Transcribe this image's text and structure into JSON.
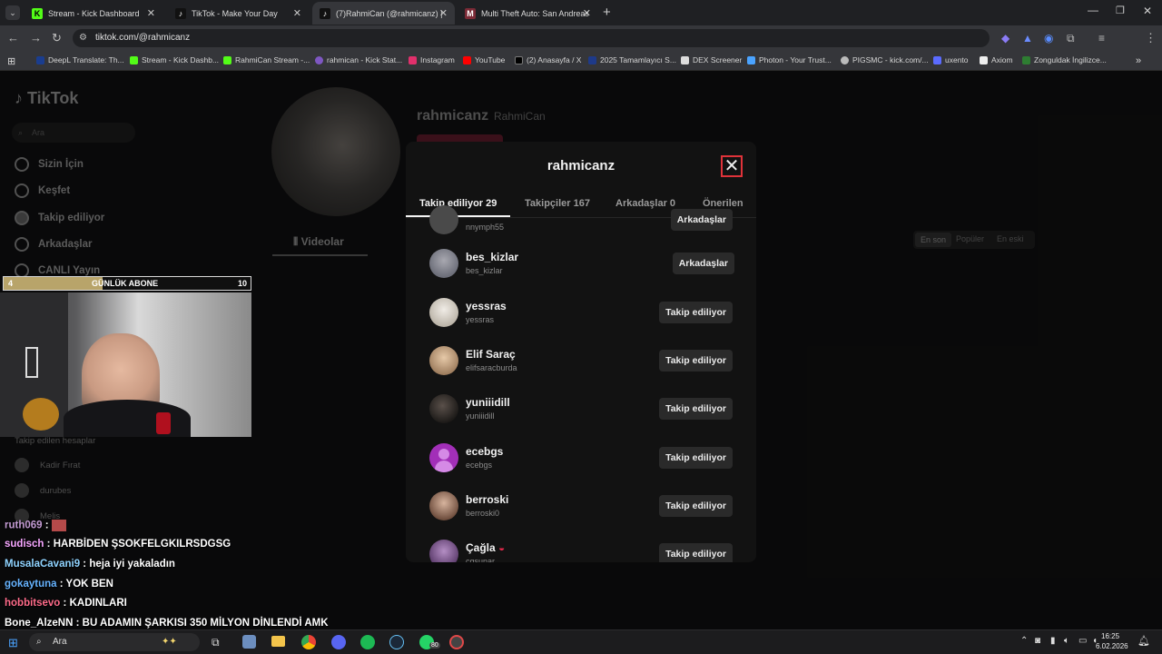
{
  "browser": {
    "tabs": [
      {
        "title": "Stream - Kick Dashboard",
        "favicon": "kick-icon"
      },
      {
        "title": "TikTok - Make Your Day",
        "favicon": "tiktok-icon"
      },
      {
        "title": "(7)RahmiCan (@rahmicanz) | Ti",
        "favicon": "tiktok-icon"
      },
      {
        "title": "Multi Theft Auto: San Andreas",
        "favicon": "mta-icon"
      }
    ],
    "url": "tiktok.com/@rahmicanz",
    "bookmarks": [
      "DeepL Translate: Th...",
      "Stream - Kick Dashb...",
      "RahmiCan Stream -...",
      "rahmican - Kick Stat...",
      "Instagram",
      "YouTube",
      "(2) Anasayfa / X",
      "2025 Tamamlayıcı S...",
      "DEX Screener",
      "Photon - Your Trust...",
      "PIGSMC - kick.com/...",
      "uxento",
      "Axiom",
      "Zonguldak İngilizce..."
    ]
  },
  "tiktok": {
    "logo": "TikTok",
    "search_placeholder": "Ara",
    "nav": [
      "Sizin İçin",
      "Keşfet",
      "Takip ediliyor",
      "Arkadaşlar",
      "CANLI Yayın"
    ],
    "profile": {
      "username": "rahmicanz",
      "display_name": "RahmiCan",
      "tab_videos": "Videolar",
      "sort": [
        "En son",
        "Popüler",
        "En eski"
      ]
    },
    "following_header": "Takip edilen hesaplar",
    "following_sidebar": [
      "Kadir Fırat",
      "durubes",
      "Melis"
    ]
  },
  "modal": {
    "title": "rahmicanz",
    "tabs": [
      "Takip ediliyor 29",
      "Takipçiler 167",
      "Arkadaşlar 0",
      "Önerilen"
    ],
    "partial_top": {
      "handle": "nnymph55",
      "button": "Arkadaşlar"
    },
    "users": [
      {
        "name": "bes_kizlar",
        "handle": "bes_kizlar",
        "button": "Arkadaşlar",
        "color": "#6d6f7a"
      },
      {
        "name": "yessras",
        "handle": "yessras",
        "button": "Takip ediliyor",
        "color": "#d9d4cc"
      },
      {
        "name": "Elif Saraç",
        "handle": "elifsaracburda",
        "button": "Takip ediliyor",
        "color": "#c6a98a"
      },
      {
        "name": "yuniiidill",
        "handle": "yuniiidill",
        "button": "Takip ediliyor",
        "color": "#3a3430"
      },
      {
        "name": "ecebgs",
        "handle": "ecebgs",
        "button": "Takip ediliyor",
        "color": "#a22fb8"
      },
      {
        "name": "berroski",
        "handle": "berroski0",
        "button": "Takip ediliyor",
        "color": "#8d6e63"
      },
      {
        "name": "Çağla",
        "handle": "cgsunar",
        "button": "Takip ediliyor",
        "color": "#7e5a8f"
      }
    ]
  },
  "overlay": {
    "abone_left": "4",
    "abone_label": "GÜNLÜK ABONE",
    "abone_right": "10",
    "abone_progress": 0.4,
    "chat": [
      {
        "user": "ruth069",
        "msg": "",
        "color": "#c39bd3"
      },
      {
        "user": "sudisch",
        "msg": "HARBİDEN ŞSOKFELGKILRSDGSG",
        "color": "#f6a6ff"
      },
      {
        "user": "MusalaCavani9",
        "msg": "heja iyi yakaladın",
        "color": "#8fd3ff"
      },
      {
        "user": "gokaytuna",
        "msg": "YOK BEN",
        "color": "#66b3ff"
      },
      {
        "user": "hobbitsevo",
        "msg": "KADINLARI",
        "color": "#ff6b8a"
      },
      {
        "user": "Bone_AlzeNN",
        "msg": "BU ADAMIN ŞARKISI 350 MİLYON DİNLENDİ AMK",
        "color": "#ffffff"
      }
    ]
  },
  "taskbar": {
    "search": "Ara",
    "time": "16:25",
    "date": "6.02.2026",
    "whatsapp_badge": "80"
  }
}
